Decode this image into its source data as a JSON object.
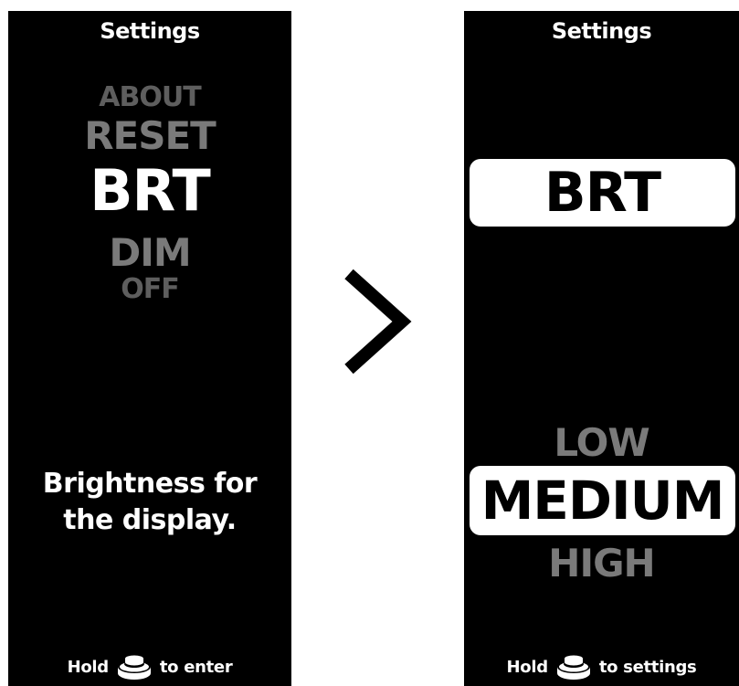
{
  "left_screen": {
    "title": "Settings",
    "menu": {
      "items": [
        "ABOUT",
        "RESET",
        "BRT",
        "DIM",
        "OFF"
      ],
      "selected": "BRT"
    },
    "description": {
      "line1": "Brightness for",
      "line2": "the display."
    },
    "hint": {
      "prefix": "Hold",
      "icon": "push-button-icon",
      "suffix": "to enter"
    }
  },
  "navigation": {
    "icon": "chevron-right-icon"
  },
  "right_screen": {
    "title": "Settings",
    "setting_name": "BRT",
    "options": {
      "items": [
        "LOW",
        "MEDIUM",
        "HIGH"
      ],
      "selected": "MEDIUM"
    },
    "hint": {
      "prefix": "Hold",
      "icon": "push-button-icon",
      "suffix": "to settings"
    }
  },
  "colors": {
    "screen_background": "#000000",
    "selected_text": "#ffffff",
    "unselected_text": "#7a7a7a",
    "highlight_pill": "#ffffff"
  }
}
